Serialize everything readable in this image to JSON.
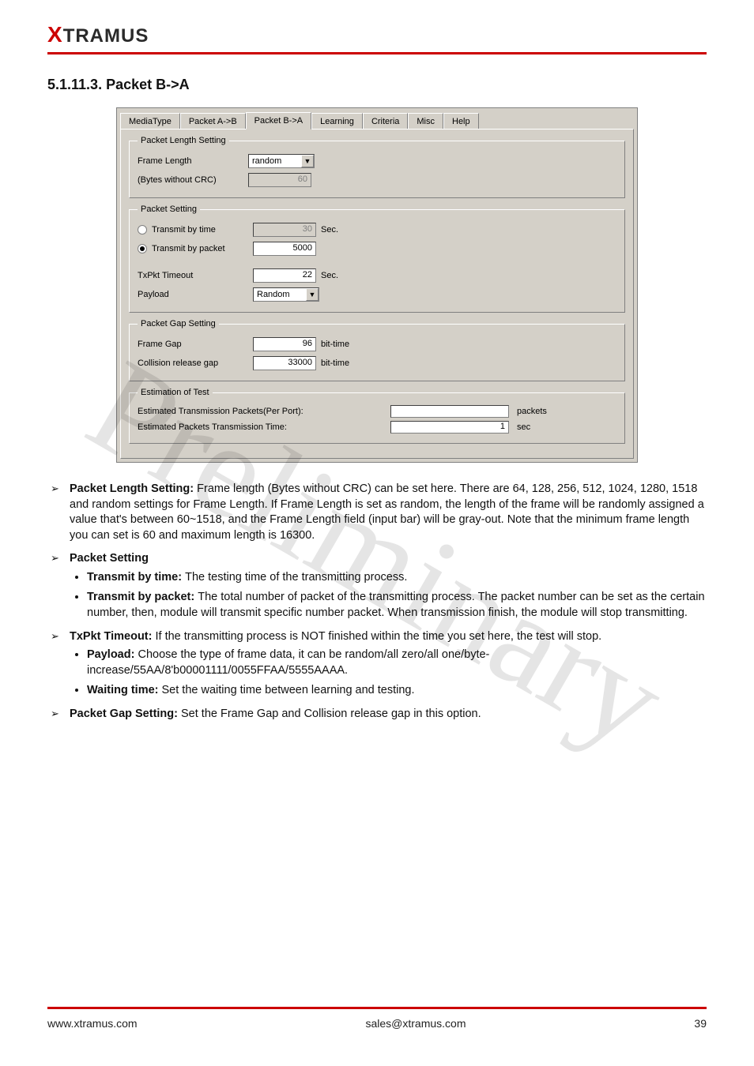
{
  "logo": {
    "x": "X",
    "rest": "TRAMUS"
  },
  "section_title": "5.1.11.3. Packet B->A",
  "watermark": "Preliminary",
  "dialog": {
    "tabs": [
      "MediaType",
      "Packet A->B",
      "Packet B->A",
      "Learning",
      "Criteria",
      "Misc",
      "Help"
    ],
    "active_tab_index": 2,
    "groups": {
      "pkt_len": {
        "legend": "Packet Length Setting",
        "frame_length_label": "Frame Length",
        "frame_length_value": "random",
        "bytes_label": "(Bytes without CRC)",
        "bytes_value": "60"
      },
      "pkt_set": {
        "legend": "Packet Setting",
        "tx_by_time_label": "Transmit by time",
        "tx_by_time_value": "30",
        "tx_by_time_unit": "Sec.",
        "tx_by_pkt_label": "Transmit by packet",
        "tx_by_pkt_value": "5000",
        "txpkt_timeout_label": "TxPkt Timeout",
        "txpkt_timeout_value": "22",
        "txpkt_timeout_unit": "Sec.",
        "payload_label": "Payload",
        "payload_value": "Random",
        "selected_radio": "packet"
      },
      "pkt_gap": {
        "legend": "Packet Gap Setting",
        "frame_gap_label": "Frame Gap",
        "frame_gap_value": "96",
        "frame_gap_unit": "bit-time",
        "coll_label": "Collision release gap",
        "coll_value": "33000",
        "coll_unit": "bit-time"
      },
      "est": {
        "legend": "Estimation of Test",
        "row1_label": "Estimated Transmission Packets(Per Port):",
        "row1_value": "",
        "row1_unit": "packets",
        "row2_label": "Estimated Packets Transmission Time:",
        "row2_value": "1",
        "row2_unit": "sec"
      }
    }
  },
  "text": {
    "b1_head": "Packet Length Setting: ",
    "b1_body": "Frame length (Bytes without CRC) can be set here. There are 64, 128, 256, 512, 1024, 1280, 1518 and random settings for Frame Length. If Frame Length is set as random, the length of the frame will be randomly assigned a value that's between 60~1518, and the Frame Length field (input bar) will be gray-out. Note that the minimum frame length you can set is 60 and maximum length is 16300.",
    "b2_head": "Packet Setting",
    "b2_s1_head": "Transmit by time: ",
    "b2_s1_body": "The testing time of the transmitting process.",
    "b2_s2_head": "Transmit by packet: ",
    "b2_s2_body": "The total number of packet of the transmitting process. The packet number can be set as the certain number, then, module will transmit specific number packet. When transmission finish, the module will stop transmitting.",
    "b3_head": "TxPkt Timeout: ",
    "b3_body": "If the transmitting process is NOT finished within the time you set here, the test will stop.",
    "b3_s1_head": "Payload: ",
    "b3_s1_body": "Choose the type of frame data, it can be random/all zero/all one/byte-increase/55AA/8'b00001111/0055FFAA/5555AAAA.",
    "b3_s2_head": "Waiting time: ",
    "b3_s2_body": "Set the waiting time between learning and testing.",
    "b4_head": "Packet Gap Setting: ",
    "b4_body": "Set the Frame Gap and Collision release gap in this option."
  },
  "footer": {
    "left": "www.xtramus.com",
    "center": "sales@xtramus.com",
    "right": "39"
  }
}
